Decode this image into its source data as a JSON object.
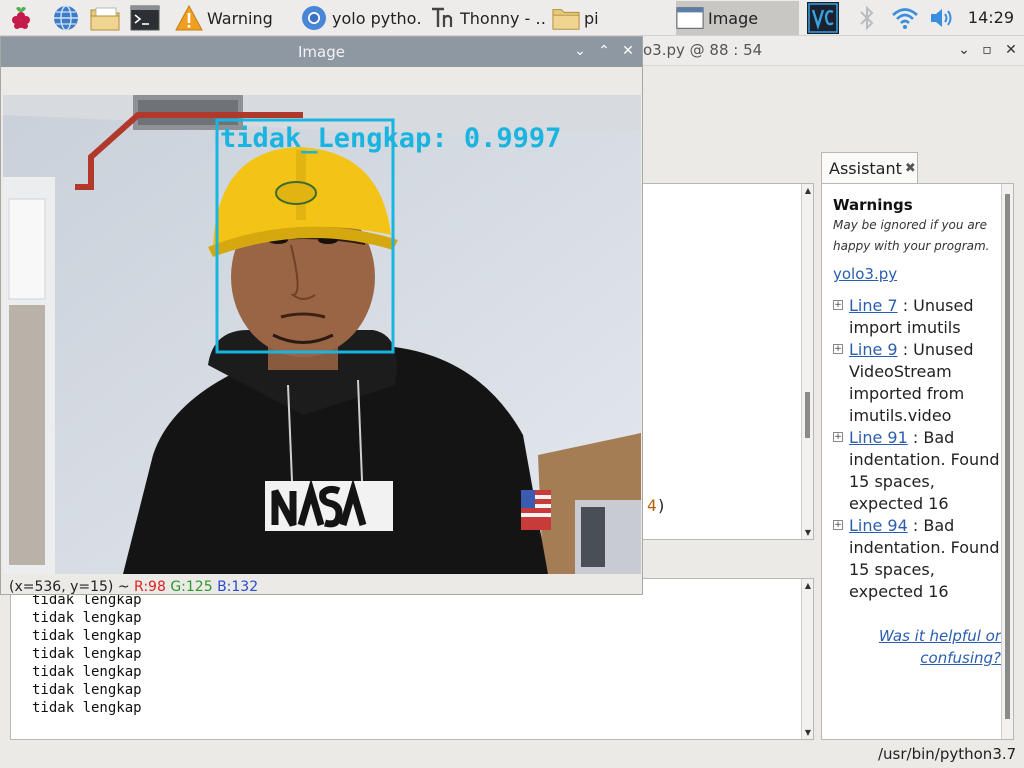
{
  "taskbar": {
    "tasks": [
      {
        "label": "Warning",
        "icon": "warning-icon"
      },
      {
        "label": "yolo pytho…",
        "icon": "chromium-icon"
      },
      {
        "label": "Thonny  -  …",
        "icon": "thonny-icon"
      },
      {
        "label": "pi",
        "icon": "folder-icon"
      },
      {
        "label": "Image",
        "icon": "window-icon",
        "active": true
      }
    ],
    "launchers": [
      "raspberry-menu-icon",
      "browser-globe-icon",
      "file-manager-icon",
      "terminal-icon"
    ],
    "tray": [
      "vnc-icon",
      "bluetooth-icon",
      "wifi-icon",
      "volume-icon"
    ],
    "clock": "14:29"
  },
  "thonny": {
    "title_fragment": "o3.py  @  88 : 54",
    "editor_fragment": {
      "num": "4",
      "paren": ")"
    },
    "shell_lines": [
      "tidak lengkap",
      "tidak lengkap",
      "tidak lengkap",
      "tidak lengkap",
      "tidak lengkap",
      "tidak lengkap",
      "tidak lengkap"
    ],
    "status": "/usr/bin/python3.7"
  },
  "assistant": {
    "tab_label": "Assistant",
    "heading": "Warnings",
    "subheading": "May be ignored if you are happy with your program.",
    "file_link": "yolo3.py",
    "warnings": [
      {
        "link": "Line 7",
        "text": ": Unused import imutils"
      },
      {
        "link": "Line 9",
        "text": ": Unused VideoStream imported from imutils.video"
      },
      {
        "link": "Line 91",
        "text": ": Bad indentation. Found 15 spaces, expected 16"
      },
      {
        "link": "Line 94",
        "text": ": Bad indentation. Found 15 spaces, expected 16"
      }
    ],
    "feedback": "Was it helpful or confusing?"
  },
  "image_window": {
    "title": "Image",
    "detection_label": "tidak_Lengkap: 0.9997",
    "status_prefix": "(x=536, y=15) ~ ",
    "r": "R:98",
    "g": "G:125",
    "b": "B:132"
  },
  "colors": {
    "detection_box": "#19b4e0",
    "link": "#2a5db0",
    "helmet": "#f3c316",
    "image_titlebar": "#8d98a3"
  }
}
